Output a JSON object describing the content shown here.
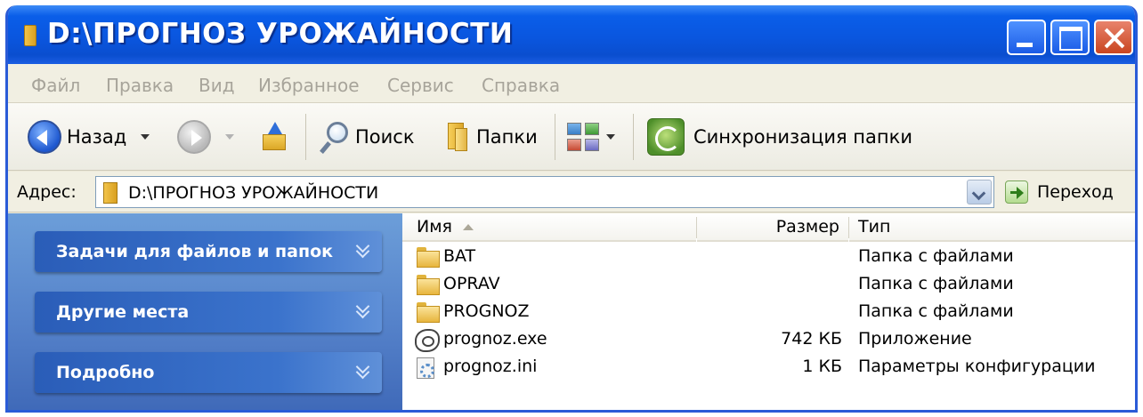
{
  "window": {
    "title": "D:\\ПРОГНОЗ УРОЖАЙНОСТИ"
  },
  "menu": {
    "items": [
      "Файл",
      "Правка",
      "Вид",
      "Избранное",
      "Сервис",
      "Справка"
    ]
  },
  "toolbar": {
    "back_label": "Назад",
    "search_label": "Поиск",
    "folders_label": "Папки",
    "sync_label": "Синхронизация папки"
  },
  "address": {
    "label": "Адрес:",
    "value": "D:\\ПРОГНОЗ УРОЖАЙНОСТИ",
    "go_label": "Переход"
  },
  "taskpane": {
    "sections": [
      "Задачи для файлов и папок",
      "Другие места",
      "Подробно"
    ]
  },
  "filelist": {
    "columns": {
      "name": "Имя",
      "size": "Размер",
      "type": "Тип"
    },
    "rows": [
      {
        "icon": "folder-icon",
        "name": "BAT",
        "size": "",
        "type": "Папка с файлами"
      },
      {
        "icon": "folder-icon",
        "name": "OPRAV",
        "size": "",
        "type": "Папка с файлами"
      },
      {
        "icon": "folder-icon",
        "name": "PROGNOZ",
        "size": "",
        "type": "Папка с файлами"
      },
      {
        "icon": "exe-icon",
        "name": "prognoz.exe",
        "size": "742 КБ",
        "type": "Приложение"
      },
      {
        "icon": "ini-icon",
        "name": "prognoz.ini",
        "size": "1 КБ",
        "type": "Параметры конфигурации"
      }
    ]
  }
}
